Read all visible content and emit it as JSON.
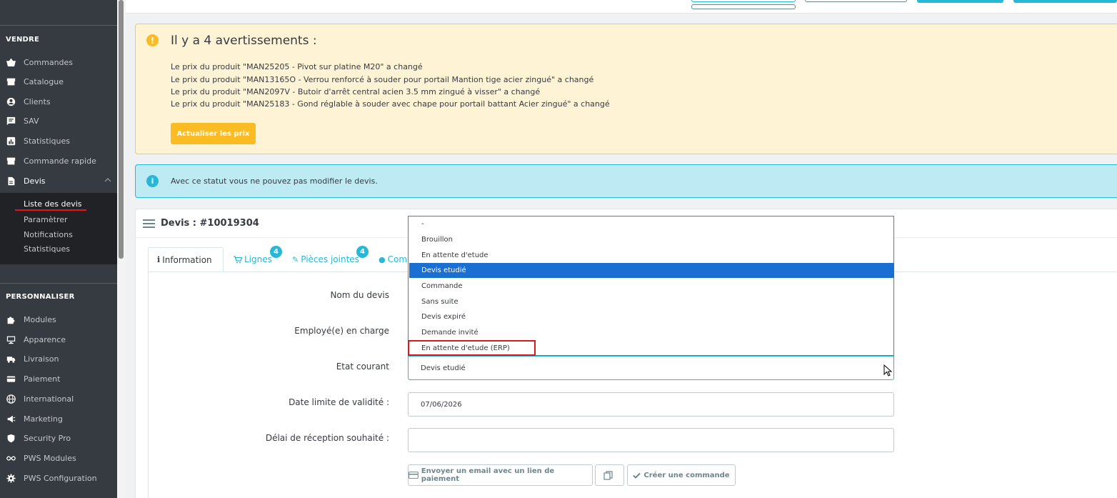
{
  "sidebar": {
    "section_sell": "VENDRE",
    "sell_items": [
      {
        "label": "Commandes",
        "icon": "basket-icon"
      },
      {
        "label": "Catalogue",
        "icon": "store-icon"
      },
      {
        "label": "Clients",
        "icon": "account-icon"
      },
      {
        "label": "SAV",
        "icon": "chat-icon"
      },
      {
        "label": "Statistiques",
        "icon": "stats-icon"
      },
      {
        "label": "Commande rapide",
        "icon": "store-icon"
      },
      {
        "label": "Devis",
        "icon": "document-icon"
      }
    ],
    "devis_sub": [
      "Liste des devis",
      "Paramètrer",
      "Notifications",
      "Statistiques"
    ],
    "section_custom": "PERSONNALISER",
    "custom_items": [
      {
        "label": "Modules",
        "icon": "puzzle-icon"
      },
      {
        "label": "Apparence",
        "icon": "monitor-icon"
      },
      {
        "label": "Livraison",
        "icon": "truck-icon"
      },
      {
        "label": "Paiement",
        "icon": "card-icon"
      },
      {
        "label": "International",
        "icon": "globe-icon"
      },
      {
        "label": "Marketing",
        "icon": "megaphone-icon"
      },
      {
        "label": "Security Pro",
        "icon": "shield-icon"
      },
      {
        "label": "PWS Modules",
        "icon": "infinity-icon"
      },
      {
        "label": "PWS Configuration",
        "icon": "gear-icon"
      }
    ]
  },
  "warning": {
    "title": "Il y a 4 avertissements :",
    "lines": [
      "Le prix du produit \"MAN25205 - Pivot sur platine M20\" a changé",
      "Le prix du produit \"MAN13165O - Verrou renforcé à souder pour portail Mantion tige acier zingué\" a changé",
      "Le prix du produit \"MAN2097V - Butoir d'arrêt central acien 3.5 mm zingué à visser\" a changé",
      "Le prix du produit \"MAN25183 - Gond réglable à souder avec chape pour portail battant Acier zingué\" a changé"
    ],
    "button": "Actualiser les prix"
  },
  "info": {
    "text": "Avec ce statut vous ne pouvez pas modifier le devis."
  },
  "panel": {
    "title": "Devis : #10019304",
    "tabs": [
      {
        "label": "Information",
        "icon": "i"
      },
      {
        "label": "Lignes",
        "badge": "4"
      },
      {
        "label": "Pièces jointes",
        "badge": "4"
      },
      {
        "label": "Com"
      }
    ],
    "form": {
      "name_label": "Nom du devis",
      "employee_label": "Employé(e) en charge",
      "state_label": "Etat courant",
      "validity_label": "Date limite de validité :",
      "validity_value": "07/06/2026",
      "delay_label": "Délai de réception souhaité :",
      "delay_value": ""
    },
    "state_options": [
      "-",
      "Brouillon",
      "En attente d'etude",
      "Devis etudié",
      "Commande",
      "Sans suite",
      "Devis expiré",
      "Demande invité",
      "En attente d'etude (ERP)"
    ],
    "state_selected_index": 3,
    "state_current": "Devis etudié",
    "buttons": {
      "email": "Envoyer un email avec un lien de paiement",
      "create": "Créer une commande"
    }
  },
  "colors": {
    "sidebar_bg": "#363a41",
    "accent": "#25b9d7",
    "warning": "#fbbb22",
    "selected_option": "#1a6fd3",
    "highlight": "#e0161b"
  }
}
